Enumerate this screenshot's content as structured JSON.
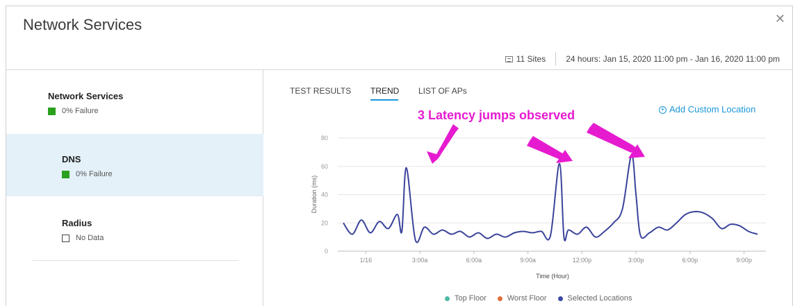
{
  "header": {
    "title": "Network Services",
    "close_icon": "close-icon"
  },
  "meta": {
    "sites": "11 Sites",
    "range": "24 hours: Jan 15, 2020 11:00 pm - Jan 16, 2020 11:00 pm"
  },
  "sidebar": {
    "items": [
      {
        "name": "Network Services",
        "status": "0% Failure",
        "indicator": "green"
      },
      {
        "name": "DNS",
        "status": "0% Failure",
        "indicator": "green",
        "selected": true
      },
      {
        "name": "Radius",
        "status": "No Data",
        "indicator": "empty"
      }
    ]
  },
  "tabs": [
    {
      "label": "TEST RESULTS"
    },
    {
      "label": "TREND",
      "active": true
    },
    {
      "label": "LIST OF APs"
    }
  ],
  "actions": {
    "add_location": "Add Custom Location"
  },
  "annotation": {
    "text": "3 Latency jumps observed",
    "color": "#e61bd0"
  },
  "colors": {
    "accent": "#1b96d8",
    "line": "#39439a",
    "highlight": "#e4f1f9"
  },
  "chart_data": {
    "type": "line",
    "xlabel": "Time (Hour)",
    "ylabel": "Duration (ms)",
    "ylim": [
      0,
      80
    ],
    "yticks": [
      "0",
      "20",
      "40",
      "60",
      "80"
    ],
    "xticks": [
      "1/16",
      "3:00a",
      "6:00a",
      "9:00a",
      "12:00p",
      "3:00p",
      "6:00p",
      "9:00p"
    ],
    "grid": true,
    "legend": [
      {
        "name": "Top Floor",
        "color": "#4db8a4"
      },
      {
        "name": "Worst Floor",
        "color": "#e2703a"
      },
      {
        "name": "Selected Locations",
        "color": "#3d4aa3"
      }
    ],
    "series": [
      {
        "name": "Selected Locations",
        "x": [
          "23:00",
          "23:30",
          "00:00",
          "00:30",
          "01:00",
          "01:30",
          "02:00",
          "02:15",
          "02:30",
          "03:00",
          "03:30",
          "04:00",
          "04:30",
          "05:00",
          "05:30",
          "06:00",
          "06:30",
          "07:00",
          "07:30",
          "08:00",
          "08:30",
          "09:00",
          "09:30",
          "10:00",
          "10:30",
          "11:00",
          "11:15",
          "11:30",
          "12:00",
          "12:30",
          "13:00",
          "13:30",
          "14:00",
          "14:30",
          "15:00",
          "15:15",
          "15:30",
          "16:00",
          "16:30",
          "17:00",
          "17:30",
          "18:00",
          "18:30",
          "19:00",
          "19:30",
          "20:00",
          "20:30",
          "21:00",
          "21:30",
          "22:00"
        ],
        "values": [
          20,
          12,
          22,
          13,
          21,
          16,
          26,
          14,
          59,
          8,
          17,
          12,
          15,
          12,
          14,
          10,
          13,
          9,
          12,
          10,
          13,
          14,
          13,
          14,
          11,
          62,
          10,
          15,
          12,
          17,
          10,
          14,
          20,
          30,
          68,
          40,
          11,
          13,
          17,
          15,
          20,
          26,
          28,
          27,
          23,
          16,
          19,
          18,
          14,
          12
        ]
      }
    ]
  }
}
